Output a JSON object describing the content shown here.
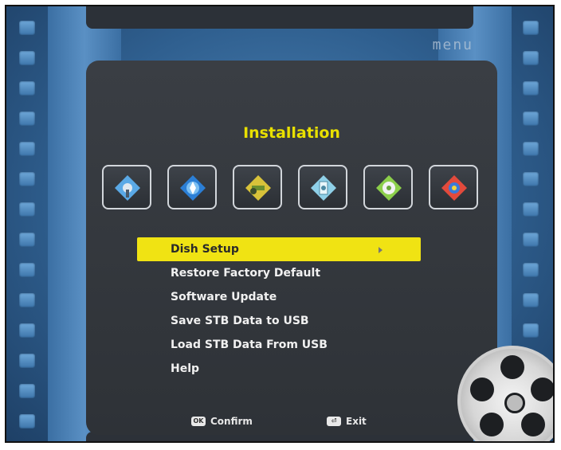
{
  "header": {
    "menu_label": "menu",
    "title": "Installation"
  },
  "icons": [
    {
      "name": "dish-setup-icon",
      "color": "#5aa9e6"
    },
    {
      "name": "satellite-search-icon",
      "color": "#2b7fd6"
    },
    {
      "name": "tools-icon",
      "color": "#d8c23a"
    },
    {
      "name": "usb-transfer-icon",
      "color": "#8fd0e8"
    },
    {
      "name": "media-settings-icon",
      "color": "#8ccf4a"
    },
    {
      "name": "help-icon",
      "color": "#e24a3c"
    }
  ],
  "menu": {
    "items": [
      {
        "label": "Dish Setup",
        "selected": true
      },
      {
        "label": "Restore Factory Default",
        "selected": false
      },
      {
        "label": "Software Update",
        "selected": false
      },
      {
        "label": "Save STB Data to USB",
        "selected": false
      },
      {
        "label": "Load STB Data From USB",
        "selected": false
      },
      {
        "label": "Help",
        "selected": false
      }
    ]
  },
  "footer": {
    "confirm_key": "OK",
    "confirm_label": "Confirm",
    "exit_key": "⏎",
    "exit_label": "Exit"
  },
  "colors": {
    "accent": "#f0e313",
    "title": "#e9e000",
    "panel": "#2e3237",
    "background": "#2f5f8f"
  }
}
